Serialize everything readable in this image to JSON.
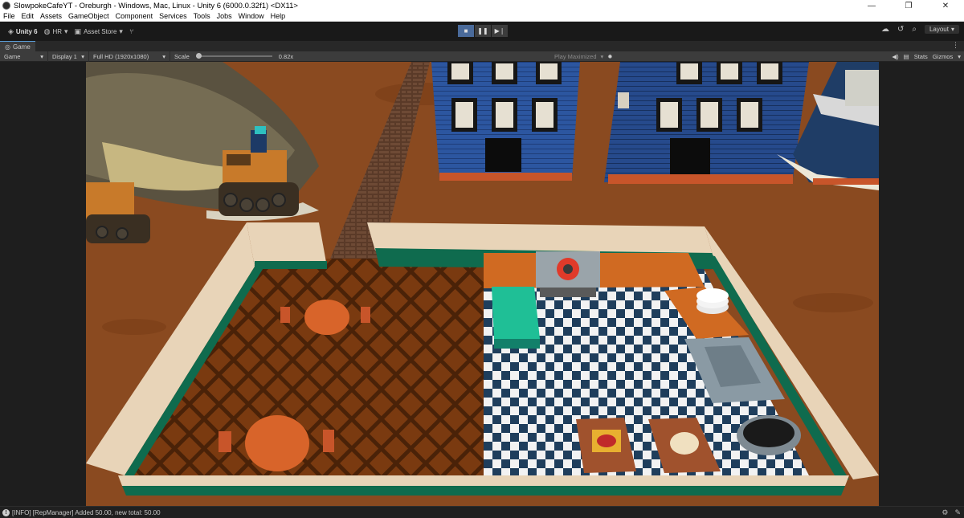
{
  "window": {
    "title": "SlowpokeCafeYT - Oreburgh - Windows, Mac, Linux - Unity 6 (6000.0.32f1) <DX11>",
    "minimize": "—",
    "maximize": "❐",
    "close": "✕"
  },
  "menu": [
    "File",
    "Edit",
    "Assets",
    "GameObject",
    "Component",
    "Services",
    "Tools",
    "Jobs",
    "Window",
    "Help"
  ],
  "toolbar": {
    "unity_label": "Unity 6",
    "account_label": "HR",
    "asset_store_label": "Asset Store",
    "layout_label": "Layout"
  },
  "game_tab": {
    "label": "Game"
  },
  "game_bar": {
    "mode": "Game",
    "display": "Display 1",
    "resolution": "Full HD (1920x1080)",
    "scale_label": "Scale",
    "scale_value": "0.82x",
    "play_maximized": "Play Maximized",
    "stats": "Stats",
    "gizmos": "Gizmos"
  },
  "status": {
    "message": "[INFO] [RepManager] Added 50.00, new total: 50.00"
  },
  "colors": {
    "ground": "#8a4a20",
    "wall_teal": "#0f6b4e",
    "floor_wood": "#6b3612",
    "counter_orange": "#d06a22",
    "building_blue": "#2a4f8a",
    "table_teal": "#1fbf96"
  }
}
